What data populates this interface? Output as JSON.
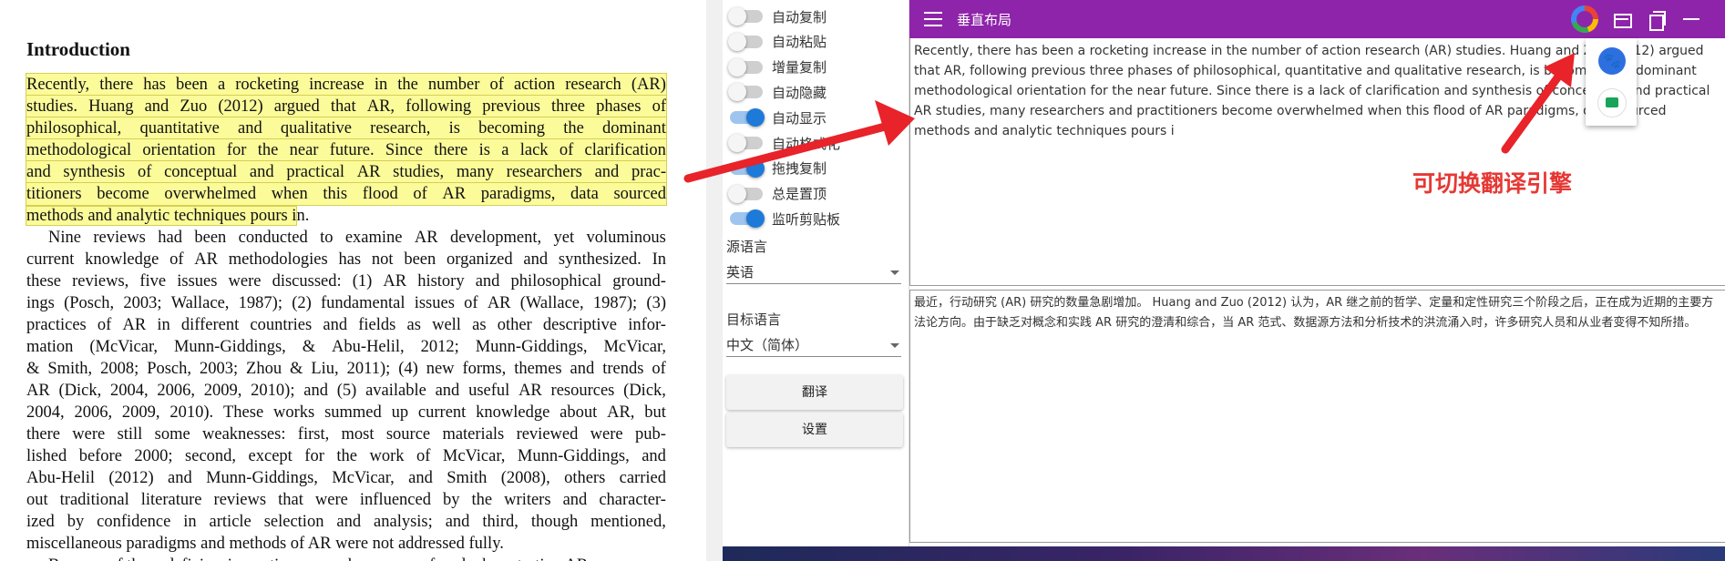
{
  "pdf": {
    "heading": "Introduction",
    "highlighted_lines": [
      [
        "Recently,",
        "there",
        "has",
        "been",
        "a",
        "rocketing",
        "increase",
        "in",
        "the",
        "number",
        "of",
        "action",
        "research",
        "(AR)"
      ],
      [
        "studies.",
        "Huang",
        "and",
        "Zuo",
        "(2012)",
        "argued",
        "that",
        "AR,",
        "following",
        "previous",
        "three",
        "phases",
        "of"
      ],
      [
        "philosophical,",
        "quantitative",
        "and",
        "qualitative",
        "research,",
        "is",
        "becoming",
        "the",
        "dominant"
      ],
      [
        "methodological",
        "orientation",
        "for",
        "the",
        "near",
        "future.",
        "Since",
        "there",
        "is",
        "a",
        "lack",
        "of",
        "clarification"
      ],
      [
        "and",
        "synthesis",
        "of",
        "conceptual",
        "and",
        "practical",
        "AR",
        "studies,",
        "many",
        "researchers",
        "and",
        "prac-"
      ],
      [
        "titioners",
        "become",
        "overwhelmed",
        "when",
        "this",
        "flood",
        "of",
        "AR",
        "paradigms,",
        "data",
        "sourced"
      ]
    ],
    "highlighted_last": "methods and analytic techniques pours i",
    "highlighted_last_rest": "n.",
    "body_first_line": "Nine reviews had been conducted to examine AR development, yet voluminous",
    "body_lines": [
      [
        "current",
        "knowledge",
        "of",
        "AR",
        "methodologies",
        "has",
        "not",
        "been",
        "organized",
        "and",
        "synthesized.",
        "In"
      ],
      [
        "these",
        "reviews,",
        "five",
        "issues",
        "were",
        "discussed:",
        "(1)",
        "AR",
        "history",
        "and",
        "philosophical",
        "ground-"
      ],
      [
        "ings",
        "(Posch,",
        "2003;",
        "Wallace,",
        "1987);",
        "(2)",
        "fundamental",
        "issues",
        "of",
        "AR",
        "(Wallace,",
        "1987);",
        "(3)"
      ],
      [
        "practices",
        "of",
        "AR",
        "in",
        "different",
        "countries",
        "and",
        "fields",
        "as",
        "well",
        "as",
        "other",
        "descriptive",
        "infor-"
      ],
      [
        "mation",
        "(McVicar,",
        "Munn-Giddings,",
        "&",
        "Abu-Helil,",
        "2012;",
        "Munn-Giddings,",
        "McVicar,"
      ],
      [
        "&",
        "Smith,",
        "2008;",
        "Posch,",
        "2003;",
        "Zhou",
        "&",
        "Liu,",
        "2011);",
        "(4)",
        "new",
        "forms,",
        "themes",
        "and",
        "trends",
        "of"
      ],
      [
        "AR",
        "(Dick,",
        "2004,",
        "2006,",
        "2009,",
        "2010);",
        "and",
        "(5)",
        "available",
        "and",
        "useful",
        "AR",
        "resources",
        "(Dick,"
      ],
      [
        "2004,",
        "2006,",
        "2009,",
        "2010).",
        "These",
        "works",
        "summed",
        "up",
        "current",
        "knowledge",
        "about",
        "AR,",
        "but"
      ],
      [
        "there",
        "were",
        "still",
        "some",
        "weaknesses:",
        "first,",
        "most",
        "source",
        "materials",
        "reviewed",
        "were",
        "pub-"
      ],
      [
        "lished",
        "before",
        "2000;",
        "second,",
        "except",
        "for",
        "the",
        "work",
        "of",
        "McVicar,",
        "Munn-Giddings,",
        "and"
      ],
      [
        "Abu-Helil",
        "(2012)",
        "and",
        "Munn-Giddings,",
        "McVicar,",
        "and",
        "Smith",
        "(2008),",
        "others",
        "carried"
      ],
      [
        "out",
        "traditional",
        "literature",
        "reviews",
        "that",
        "were",
        "influenced",
        "by",
        "the",
        "writers",
        "and",
        "character-"
      ],
      [
        "ized",
        "by",
        "confidence",
        "in",
        "article",
        "selection",
        "and",
        "analysis;",
        "and",
        "third,",
        "though",
        "mentioned,"
      ]
    ],
    "body_last": "miscellaneous paradigms and methods of AR were not addressed fully.",
    "body_cut": "Because of these deficiencies, action researchers are confused when starting AR"
  },
  "sidebar": {
    "toggles": [
      {
        "label": "自动复制",
        "on": false
      },
      {
        "label": "自动粘贴",
        "on": false
      },
      {
        "label": "增量复制",
        "on": false
      },
      {
        "label": "自动隐藏",
        "on": false
      },
      {
        "label": "自动显示",
        "on": true
      },
      {
        "label": "自动格式化",
        "on": false
      },
      {
        "label": "拖拽复制",
        "on": true
      },
      {
        "label": "总是置顶",
        "on": false
      },
      {
        "label": "监听剪贴板",
        "on": true
      }
    ],
    "source_lang_label": "源语言",
    "source_lang_value": "英语",
    "target_lang_label": "目标语言",
    "target_lang_value": "中文（简体）",
    "translate_button": "翻译",
    "settings_button": "设置"
  },
  "titlebar": {
    "title": "垂直布局",
    "baidu_glyph": "🐾"
  },
  "source_text": "Recently, there has been a rocketing increase in the number of action research (AR) studies. Huang and Zuo (2012) argued that AR, following previous three phases of philosophical, quantitative and qualitative research, is becoming the dominant methodological orientation for the near future. Since there is a lack of clarification and synthesis of conceptual and practical AR studies, many researchers and practitioners become overwhelmed when this flood of AR paradigms, data sourced methods and analytic techniques pours i",
  "target_text": "最近，行动研究 (AR) 研究的数量急剧增加。 Huang and Zuo (2012) 认为，AR 继之前的哲学、定量和定性研究三个阶段之后，正在成为近期的主要方法论方向。由于缺乏对概念和实践 AR 研究的澄清和综合，当 AR 范式、数据源方法和分析技术的洪流涌入时，许多研究人员和从业者变得不知所措。",
  "annotation": {
    "caption": "可切换翻译引擎",
    "arrow_color": "#e8232a"
  }
}
